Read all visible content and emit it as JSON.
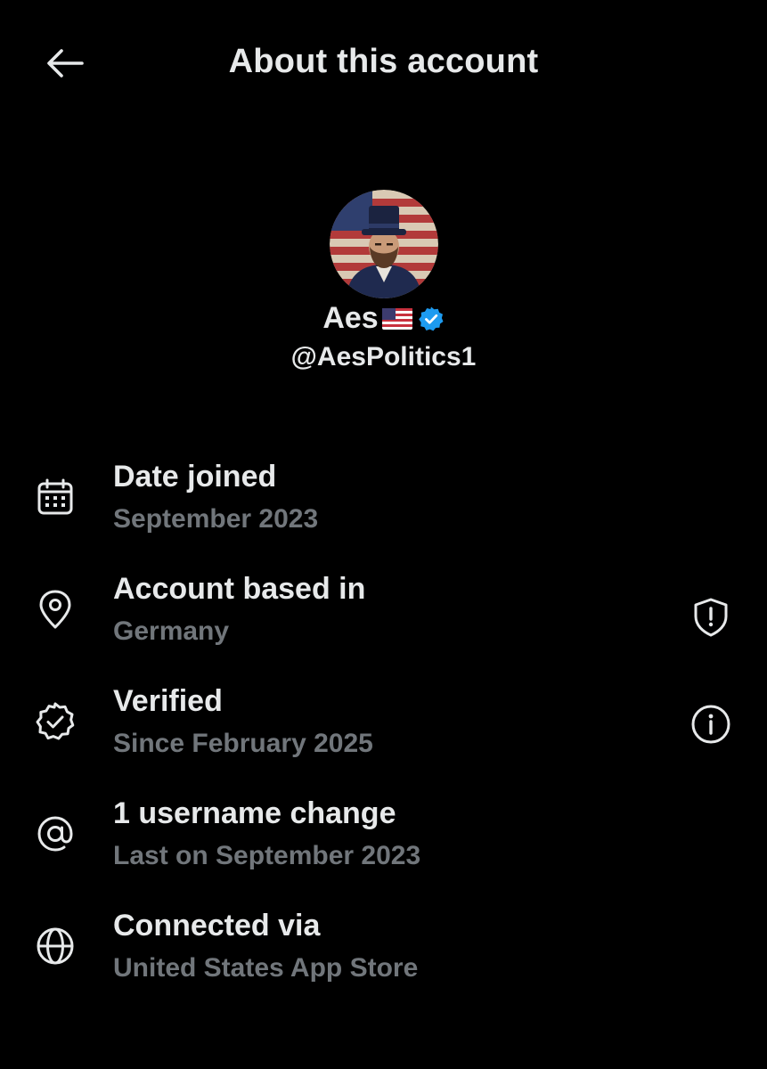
{
  "header": {
    "title": "About this account",
    "back_icon": "arrow-left-icon"
  },
  "profile": {
    "display_name": "Aes",
    "flag_icon": "us-flag-icon",
    "verified_icon": "verified-badge-icon",
    "handle": "@AesPolitics1"
  },
  "items": [
    {
      "icon": "calendar-icon",
      "title": "Date joined",
      "subtitle": "September 2023"
    },
    {
      "icon": "location-pin-icon",
      "title": "Account based in",
      "subtitle": "Germany",
      "action_icon": "shield-alert-icon"
    },
    {
      "icon": "verified-outline-icon",
      "title": "Verified",
      "subtitle": "Since February 2025",
      "action_icon": "info-icon"
    },
    {
      "icon": "at-sign-icon",
      "title": "1 username change",
      "subtitle": "Last on September 2023"
    },
    {
      "icon": "globe-icon",
      "title": "Connected via",
      "subtitle": "United States App Store"
    }
  ],
  "colors": {
    "background": "#000000",
    "primary_text": "#e7e9ea",
    "secondary_text": "#71767b",
    "verified_blue": "#1d9bf0"
  }
}
